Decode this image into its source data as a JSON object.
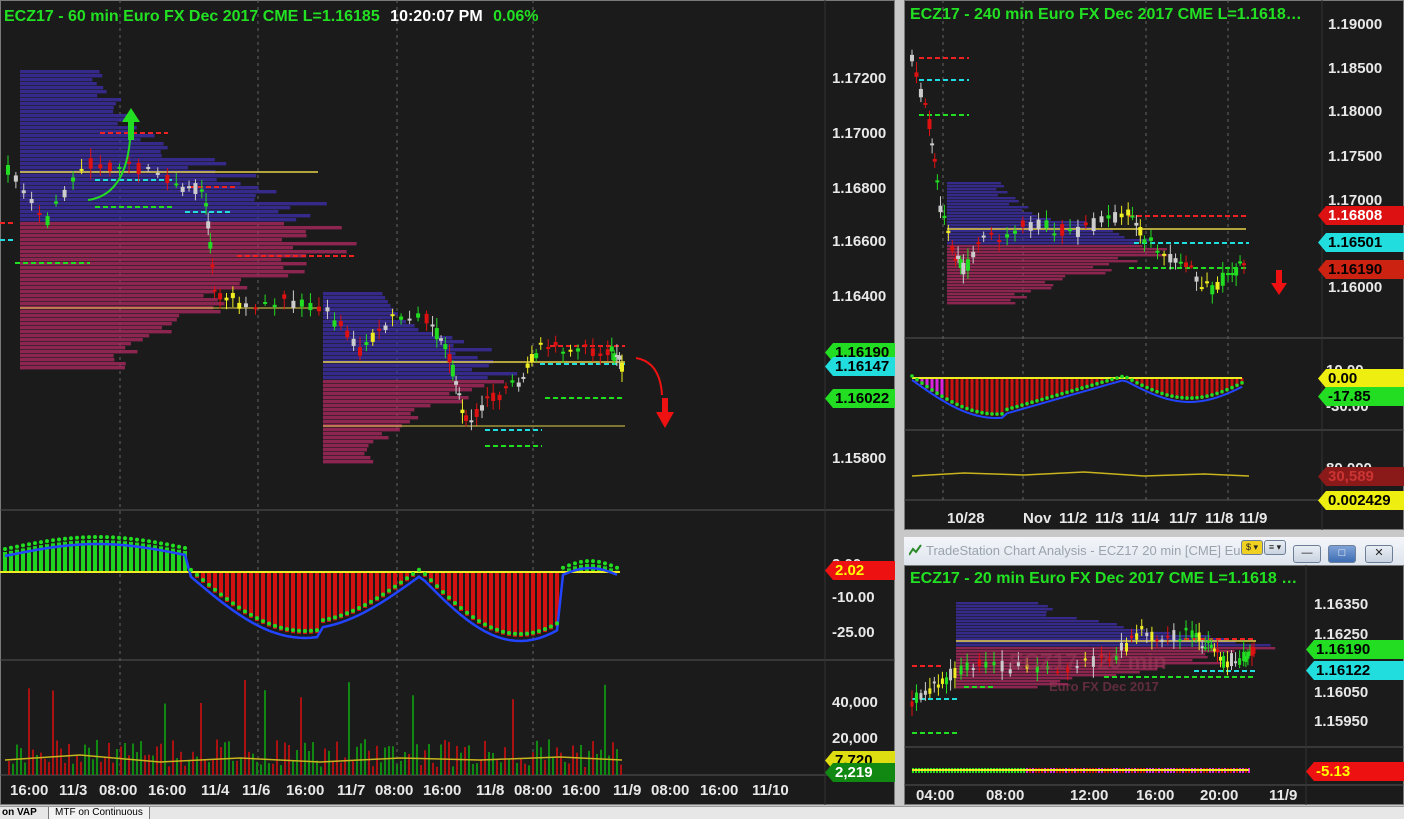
{
  "chart_main": {
    "title": {
      "symbol_tf": "ECZ17 - 60 min  Euro FX Dec 2017  CME  L=1.16185",
      "time": "10:20:07 PM",
      "pct": "0.06%"
    },
    "price_ticks": [
      "1.17200",
      "1.17000",
      "1.16800",
      "1.16600",
      "1.16400",
      "1.15800"
    ],
    "price_badges": [
      {
        "text": "1.16190",
        "bg": "#22dd22",
        "fg": "#000000"
      },
      {
        "text": "1.16147",
        "bg": "#22dddd",
        "fg": "#000000"
      },
      {
        "text": "1.16022",
        "bg": "#22dd22",
        "fg": "#000000"
      }
    ],
    "osc_ticks": [
      "2.00",
      "-10.00",
      "-25.00"
    ],
    "osc_badge": {
      "text": "2.02",
      "bg": "#ee1111",
      "fg": "#ffff00"
    },
    "vol_ticks": [
      "40,000",
      "20,000"
    ],
    "vol_badges": [
      {
        "text": "7,720",
        "bg": "#dddd11",
        "fg": "#000000"
      },
      {
        "text": "2,219",
        "bg": "#118811",
        "fg": "#ffffff"
      }
    ],
    "time_labels": [
      "16:00",
      "11/3",
      "08:00",
      "16:00",
      "11/4",
      "11/6",
      "16:00",
      "11/7",
      "08:00",
      "16:00",
      "11/8",
      "08:00",
      "16:00",
      "11/9",
      "08:00",
      "16:00",
      "11/10"
    ]
  },
  "chart_240": {
    "title": "ECZ17 - 240 min  Euro FX Dec 2017  CME  L=1.1618…",
    "price_ticks": [
      "1.19000",
      "1.18500",
      "1.18000",
      "1.17500",
      "1.17000",
      "1.16000"
    ],
    "price_badges": [
      {
        "text": "1.16808",
        "bg": "#dd1111",
        "fg": "#ffffff"
      },
      {
        "text": "1.16501",
        "bg": "#22dddd",
        "fg": "#000000"
      },
      {
        "text": "1.16190",
        "bg": "#cc2211",
        "fg": "#000000"
      }
    ],
    "osc_ticks": [
      "10.00",
      "-30.00"
    ],
    "osc_badges": [
      {
        "text": "0.00",
        "bg": "#eeee11",
        "fg": "#000000"
      },
      {
        "text": "-17.85",
        "bg": "#22dd22",
        "fg": "#000000"
      }
    ],
    "vol_ticks": [
      "80.000"
    ],
    "vol_badges": [
      {
        "text": "30,589",
        "bg": "#8a1a1a",
        "fg": "#cc3333"
      },
      {
        "text": "0.002429",
        "bg": "#eeee11",
        "fg": "#000000"
      }
    ],
    "time_labels": [
      "10/28",
      "Nov",
      "11/2",
      "11/3",
      "11/4",
      "11/7",
      "11/8",
      "11/9"
    ]
  },
  "chart_20": {
    "window_title": "TradeStation Chart Analysis - ECZ17 20 min [CME] Eur…",
    "window_buttons": {
      "dollar": "$ ▾",
      "menu": "≡ ▾",
      "minimize": "—",
      "maximize": "□",
      "close": "✕"
    },
    "title": "ECZ17 - 20 min  Euro FX Dec 2017  CME  L=1.1618 …",
    "watermark_big": "ECZ17 - 20 min",
    "watermark_small": "Euro FX Dec 2017",
    "price_ticks": [
      "1.16350",
      "1.16250",
      "1.16050",
      "1.15950"
    ],
    "price_badges": [
      {
        "text": "1.16190",
        "bg": "#22dd22",
        "fg": "#000000"
      },
      {
        "text": "1.16122",
        "bg": "#22dddd",
        "fg": "#000000"
      }
    ],
    "osc_badge": {
      "text": "-5.13",
      "bg": "#ee1111",
      "fg": "#ffff00"
    },
    "time_labels": [
      "04:00",
      "08:00",
      "12:00",
      "16:00",
      "20:00",
      "11/9"
    ]
  },
  "tabs": [
    "on VAP",
    "MTF on Continuous"
  ],
  "colors": {
    "bg": "#1b1b1b",
    "bull": "#22dd22",
    "bear": "#dd1111",
    "doji": "#eeee22",
    "neutral": "#cccccc",
    "cyan": "#22dddd",
    "title": "#22e022"
  }
}
